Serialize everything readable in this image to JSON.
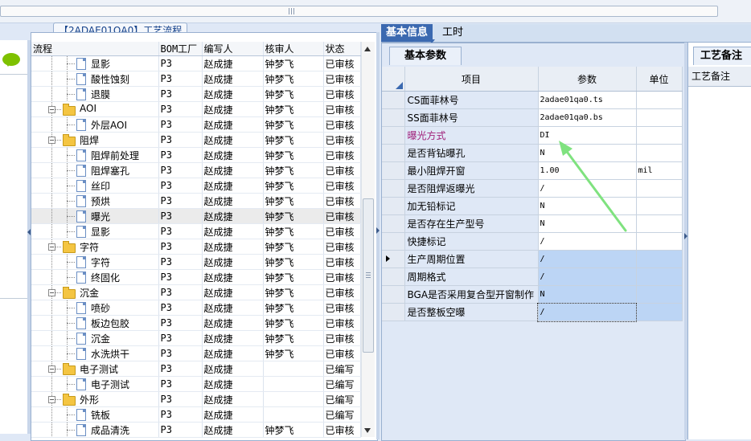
{
  "process_panel": {
    "title": "【2ADAE01QA0】工艺流程",
    "columns": [
      "流程",
      "BOM工厂",
      "编写人",
      "核审人",
      "状态"
    ],
    "rows": [
      {
        "name": "显影",
        "level": 2,
        "kind": "doc",
        "bom": "P3",
        "writer": "赵成捷",
        "reviewer": "钟梦飞",
        "status": "已审核"
      },
      {
        "name": "酸性蚀刻",
        "level": 2,
        "kind": "doc",
        "bom": "P3",
        "writer": "赵成捷",
        "reviewer": "钟梦飞",
        "status": "已审核"
      },
      {
        "name": "退膜",
        "level": 2,
        "kind": "doc",
        "bom": "P3",
        "writer": "赵成捷",
        "reviewer": "钟梦飞",
        "status": "已审核"
      },
      {
        "name": "AOI",
        "level": 1,
        "kind": "folder",
        "bom": "P3",
        "writer": "赵成捷",
        "reviewer": "钟梦飞",
        "status": "已审核"
      },
      {
        "name": "外层AOI",
        "level": 2,
        "kind": "doc",
        "bom": "P3",
        "writer": "赵成捷",
        "reviewer": "钟梦飞",
        "status": "已审核"
      },
      {
        "name": "阻焊",
        "level": 1,
        "kind": "folder",
        "bom": "P3",
        "writer": "赵成捷",
        "reviewer": "钟梦飞",
        "status": "已审核"
      },
      {
        "name": "阻焊前处理",
        "level": 2,
        "kind": "doc",
        "bom": "P3",
        "writer": "赵成捷",
        "reviewer": "钟梦飞",
        "status": "已审核"
      },
      {
        "name": "阻焊塞孔",
        "level": 2,
        "kind": "doc",
        "bom": "P3",
        "writer": "赵成捷",
        "reviewer": "钟梦飞",
        "status": "已审核"
      },
      {
        "name": "丝印",
        "level": 2,
        "kind": "doc",
        "bom": "P3",
        "writer": "赵成捷",
        "reviewer": "钟梦飞",
        "status": "已审核"
      },
      {
        "name": "预烘",
        "level": 2,
        "kind": "doc",
        "bom": "P3",
        "writer": "赵成捷",
        "reviewer": "钟梦飞",
        "status": "已审核"
      },
      {
        "name": "曝光",
        "level": 2,
        "kind": "doc",
        "bom": "P3",
        "writer": "赵成捷",
        "reviewer": "钟梦飞",
        "status": "已审核",
        "selected": true
      },
      {
        "name": "显影",
        "level": 2,
        "kind": "doc",
        "bom": "P3",
        "writer": "赵成捷",
        "reviewer": "钟梦飞",
        "status": "已审核"
      },
      {
        "name": "字符",
        "level": 1,
        "kind": "folder",
        "bom": "P3",
        "writer": "赵成捷",
        "reviewer": "钟梦飞",
        "status": "已审核"
      },
      {
        "name": "字符",
        "level": 2,
        "kind": "doc",
        "bom": "P3",
        "writer": "赵成捷",
        "reviewer": "钟梦飞",
        "status": "已审核"
      },
      {
        "name": "终固化",
        "level": 2,
        "kind": "doc",
        "bom": "P3",
        "writer": "赵成捷",
        "reviewer": "钟梦飞",
        "status": "已审核"
      },
      {
        "name": "沉金",
        "level": 1,
        "kind": "folder",
        "bom": "P3",
        "writer": "赵成捷",
        "reviewer": "钟梦飞",
        "status": "已审核"
      },
      {
        "name": "喷砂",
        "level": 2,
        "kind": "doc",
        "bom": "P3",
        "writer": "赵成捷",
        "reviewer": "钟梦飞",
        "status": "已审核"
      },
      {
        "name": "板边包胶",
        "level": 2,
        "kind": "doc",
        "bom": "P3",
        "writer": "赵成捷",
        "reviewer": "钟梦飞",
        "status": "已审核"
      },
      {
        "name": "沉金",
        "level": 2,
        "kind": "doc",
        "bom": "P3",
        "writer": "赵成捷",
        "reviewer": "钟梦飞",
        "status": "已审核"
      },
      {
        "name": "水洗烘干",
        "level": 2,
        "kind": "doc",
        "bom": "P3",
        "writer": "赵成捷",
        "reviewer": "钟梦飞",
        "status": "已审核"
      },
      {
        "name": "电子测试",
        "level": 1,
        "kind": "folder",
        "bom": "P3",
        "writer": "赵成捷",
        "reviewer": "",
        "status": "已编写"
      },
      {
        "name": "电子测试",
        "level": 2,
        "kind": "doc",
        "bom": "P3",
        "writer": "赵成捷",
        "reviewer": "",
        "status": "已编写"
      },
      {
        "name": "外形",
        "level": 1,
        "kind": "folder",
        "bom": "P3",
        "writer": "赵成捷",
        "reviewer": "",
        "status": "已编写"
      },
      {
        "name": "铣板",
        "level": 2,
        "kind": "doc",
        "bom": "P3",
        "writer": "赵成捷",
        "reviewer": "",
        "status": "已编写"
      },
      {
        "name": "成品清洗",
        "level": 2,
        "kind": "doc",
        "bom": "P3",
        "writer": "赵成捷",
        "reviewer": "钟梦飞",
        "status": "已审核"
      }
    ]
  },
  "right_tabs": {
    "basic": "基本信息",
    "time": "工时"
  },
  "params_panel": {
    "tab": "基本参数",
    "headers": {
      "item": "项目",
      "param": "参数",
      "unit": "单位"
    },
    "rows": [
      {
        "item": "CS面菲林号",
        "value": "2adae01qa0.ts",
        "unit": ""
      },
      {
        "item": "SS面菲林号",
        "value": "2adae01qa0.bs",
        "unit": ""
      },
      {
        "item": "曝光方式",
        "value": "DI",
        "unit": "",
        "purple": true
      },
      {
        "item": "是否背钻曝孔",
        "value": "N",
        "unit": ""
      },
      {
        "item": "最小阻焊开窗",
        "value": "1.00",
        "unit": "mil"
      },
      {
        "item": "是否阻焊返曝光",
        "value": "/",
        "unit": ""
      },
      {
        "item": "加无铅标记",
        "value": "N",
        "unit": ""
      },
      {
        "item": "是否存在生产型号",
        "value": "N",
        "unit": ""
      },
      {
        "item": "快捷标记",
        "value": "/",
        "unit": ""
      },
      {
        "item": "生产周期位置",
        "value": "/",
        "unit": "",
        "highlight": true,
        "current": true
      },
      {
        "item": "周期格式",
        "value": "/",
        "unit": "",
        "highlight": true
      },
      {
        "item": "BGA是否采用复合型开窗制作",
        "value": "N",
        "unit": "",
        "highlight": true
      },
      {
        "item": "是否整板空曝",
        "value": "/",
        "unit": "",
        "highlight": true
      }
    ]
  },
  "remarks_panel": {
    "tab": "工艺备注",
    "header": "工艺备注"
  },
  "colors": {
    "accent": "#3b69b0",
    "panel_bg": "#dfe8f6",
    "highlight": "#bcd5f5",
    "arrow": "#7fe27f"
  }
}
